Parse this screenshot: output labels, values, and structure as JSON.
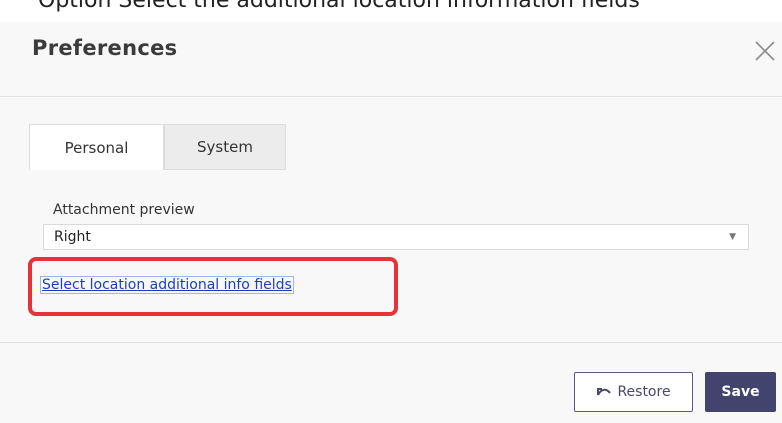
{
  "caption": "Option Select the additional location information fields",
  "dialog": {
    "title": "Preferences",
    "close_icon": "close-icon"
  },
  "tabs": [
    {
      "label": "Personal",
      "active": true
    },
    {
      "label": "System",
      "active": false
    }
  ],
  "attachment_preview": {
    "label": "Attachment preview",
    "value": "Right",
    "arrow_icon": "caret-down-icon"
  },
  "location_link": {
    "label": "Select location additional info fields"
  },
  "highlight_color": "#e8323a",
  "buttons": {
    "restore_label": "Restore",
    "restore_icon": "undo-icon",
    "save_label": "Save"
  }
}
